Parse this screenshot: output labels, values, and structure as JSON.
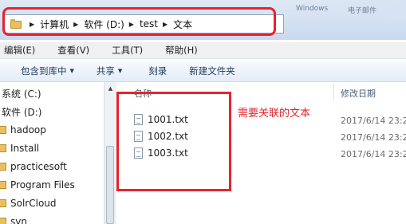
{
  "address_bar": {
    "crumbs": [
      "计算机",
      "软件 (D:)",
      "test",
      "文本"
    ]
  },
  "titlebar_blurred": [
    "Windows",
    "电子邮件"
  ],
  "menu": [
    "编辑(E)",
    "查看(V)",
    "工具(T)",
    "帮助(H)"
  ],
  "toolbar": {
    "include_library": "包含到库中",
    "share": "共享",
    "burn": "刻录",
    "new_folder": "新建文件夹"
  },
  "sidebar": {
    "items": [
      "系统 (C:)",
      "软件 (D:)",
      "hadoop",
      "Install",
      "practicesoft",
      "Program Files",
      "SolrCloud",
      "svn"
    ]
  },
  "columns": {
    "name": "名称",
    "modified": "修改日期"
  },
  "files": [
    {
      "name": "1001.txt",
      "date": "2017/6/14 23:2"
    },
    {
      "name": "1002.txt",
      "date": "2017/6/14 23:2"
    },
    {
      "name": "1003.txt",
      "date": "2017/6/14 23:2"
    }
  ],
  "annotation": "需要关联的文本",
  "colors": {
    "highlight": "#e8232b",
    "toolbar_text": "#1e395b"
  }
}
